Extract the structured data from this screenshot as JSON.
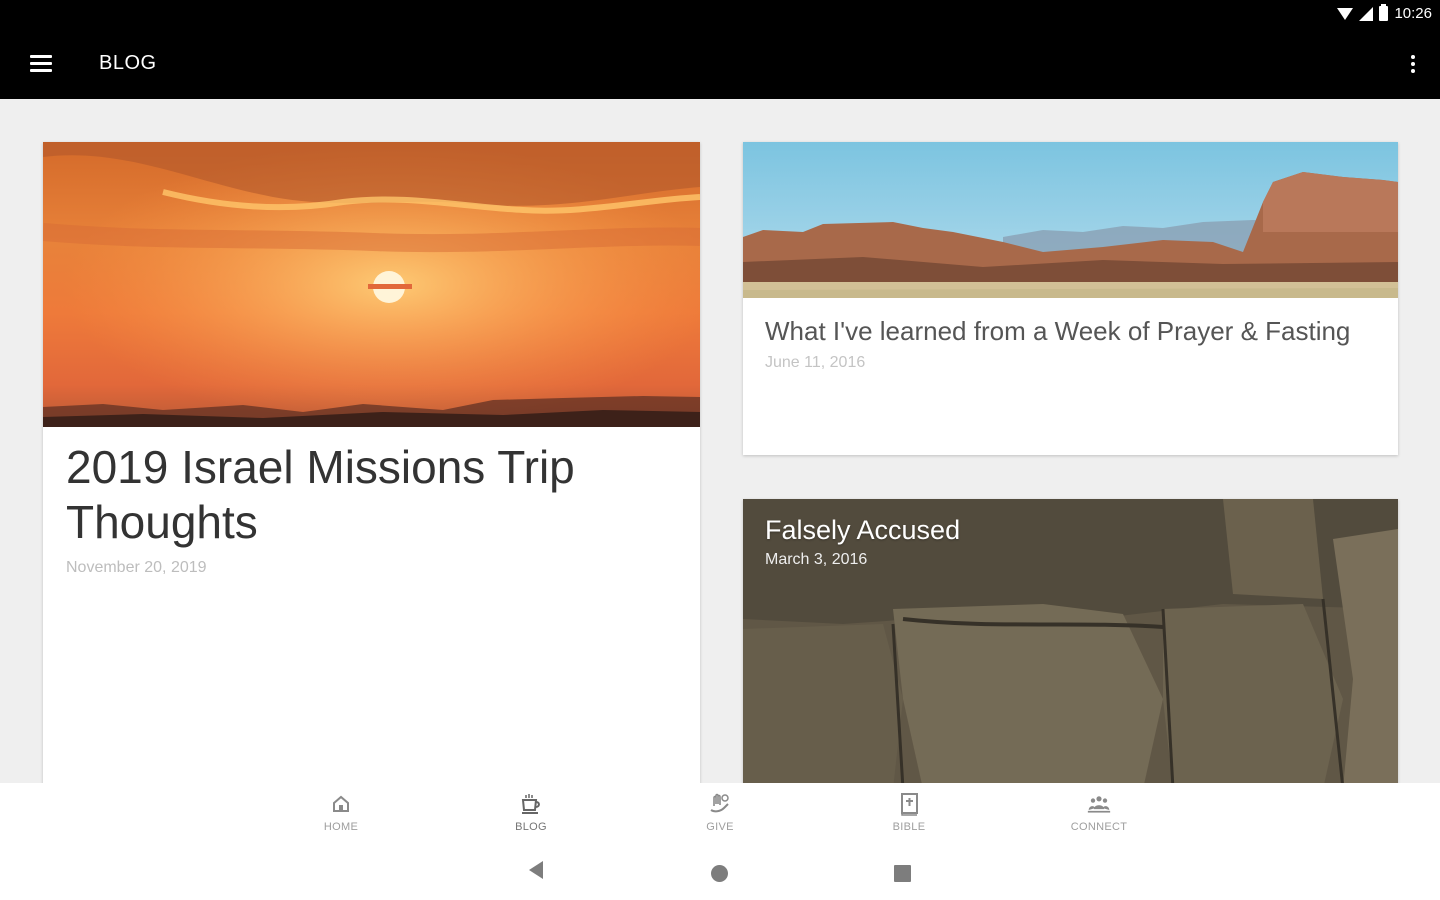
{
  "status_bar": {
    "time": "10:26",
    "icons": [
      "wifi-icon",
      "signal-icon",
      "battery-icon"
    ]
  },
  "app_bar": {
    "title": "BLOG",
    "menu_icon": "menu-icon",
    "overflow_icon": "more-vert-icon"
  },
  "posts": [
    {
      "title": "2019 Israel Missions Trip Thoughts",
      "date": "November 20, 2019",
      "image": "sunset-over-desert"
    },
    {
      "title": "What I've learned from a Week of Prayer & Fasting",
      "date": "June 11, 2016",
      "image": "canyon-mesa-landscape"
    },
    {
      "title": "Falsely Accused",
      "date": "March 3, 2016",
      "image": "stone-wall-texture"
    }
  ],
  "bottom_nav": {
    "items": [
      {
        "label": "HOME",
        "icon": "home-icon",
        "active": false
      },
      {
        "label": "BLOG",
        "icon": "coffee-cup-icon",
        "active": true
      },
      {
        "label": "GIVE",
        "icon": "give-hand-icon",
        "active": false
      },
      {
        "label": "BIBLE",
        "icon": "bible-icon",
        "active": false
      },
      {
        "label": "CONNECT",
        "icon": "people-icon",
        "active": false
      }
    ]
  },
  "system_nav": {
    "buttons": [
      "back-icon",
      "home-circle-icon",
      "recents-square-icon"
    ]
  },
  "colors": {
    "app_bar_bg": "#000000",
    "page_bg": "#efefef",
    "date_text": "#bdbdbd",
    "nav_label": "#9e9e9e"
  }
}
